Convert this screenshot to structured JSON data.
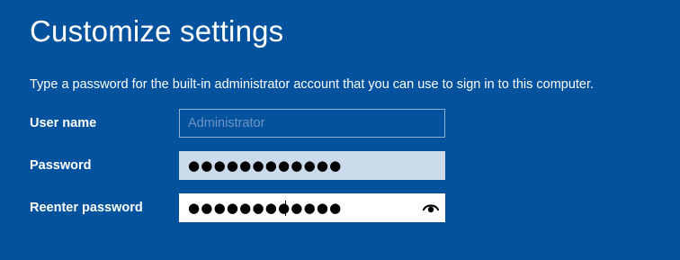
{
  "page": {
    "title": "Customize settings",
    "instruction": "Type a password for the built-in administrator account that you can use to sign in to this computer."
  },
  "form": {
    "user_name": {
      "label": "User name",
      "value": "Administrator"
    },
    "password": {
      "label": "Password",
      "masked_value": "●●●●●●●●●●●●"
    },
    "reenter_password": {
      "label": "Reenter password",
      "masked_value": "●●●●●●●●●●●●",
      "reveal_icon": "eye-icon"
    }
  },
  "colors": {
    "background": "#02529e",
    "text": "#ffffff",
    "readonly_border": "#8fb1d4",
    "readonly_text": "#6f93c0",
    "filled_field": "#ccdbeb",
    "focused_field": "#ffffff"
  }
}
